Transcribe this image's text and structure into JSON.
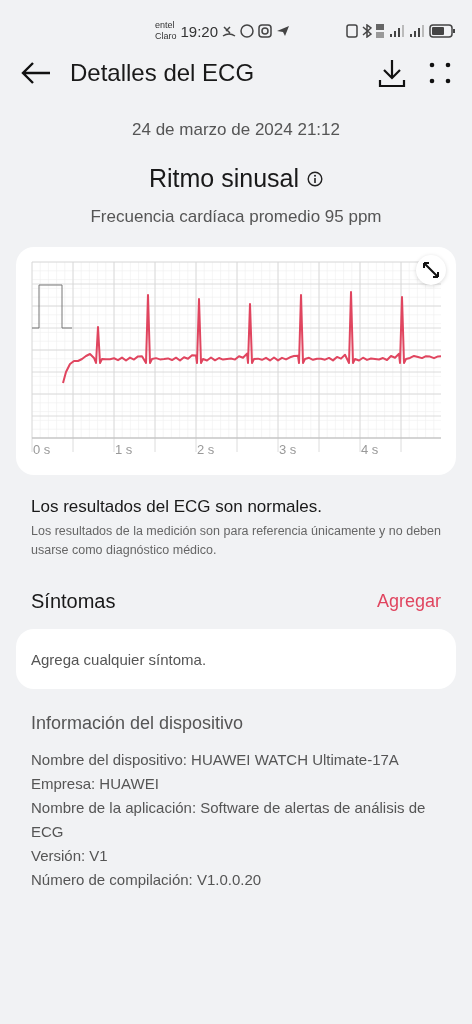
{
  "status_bar": {
    "carrier_1": "entel",
    "carrier_2": "Claro",
    "time": "19:20"
  },
  "header": {
    "title": "Detalles del ECG"
  },
  "date": "24 de marzo de 2024 21:12",
  "rhythm": {
    "title": "Ritmo sinusal",
    "subtitle": "Frecuencia cardíaca promedio 95 ppm"
  },
  "ecg": {
    "time_labels": [
      "0 s",
      "1 s",
      "2 s",
      "3 s",
      "4 s"
    ]
  },
  "result": {
    "title": "Los resultados del ECG son normales.",
    "note": "Los resultados de la medición son para referencia únicamente y no deben usarse como diagnóstico médico."
  },
  "symptoms": {
    "title": "Síntomas",
    "action": "Agregar",
    "placeholder": "Agrega cualquier síntoma."
  },
  "device_info": {
    "title": "Información del dispositivo",
    "lines": [
      "Nombre del dispositivo: HUAWEI WATCH Ultimate-17A",
      "Empresa: HUAWEI",
      "Nombre de la aplicación: Software de alertas de análisis de ECG",
      "Versión: V1",
      "Número de compilación: V1.0.0.20"
    ]
  }
}
